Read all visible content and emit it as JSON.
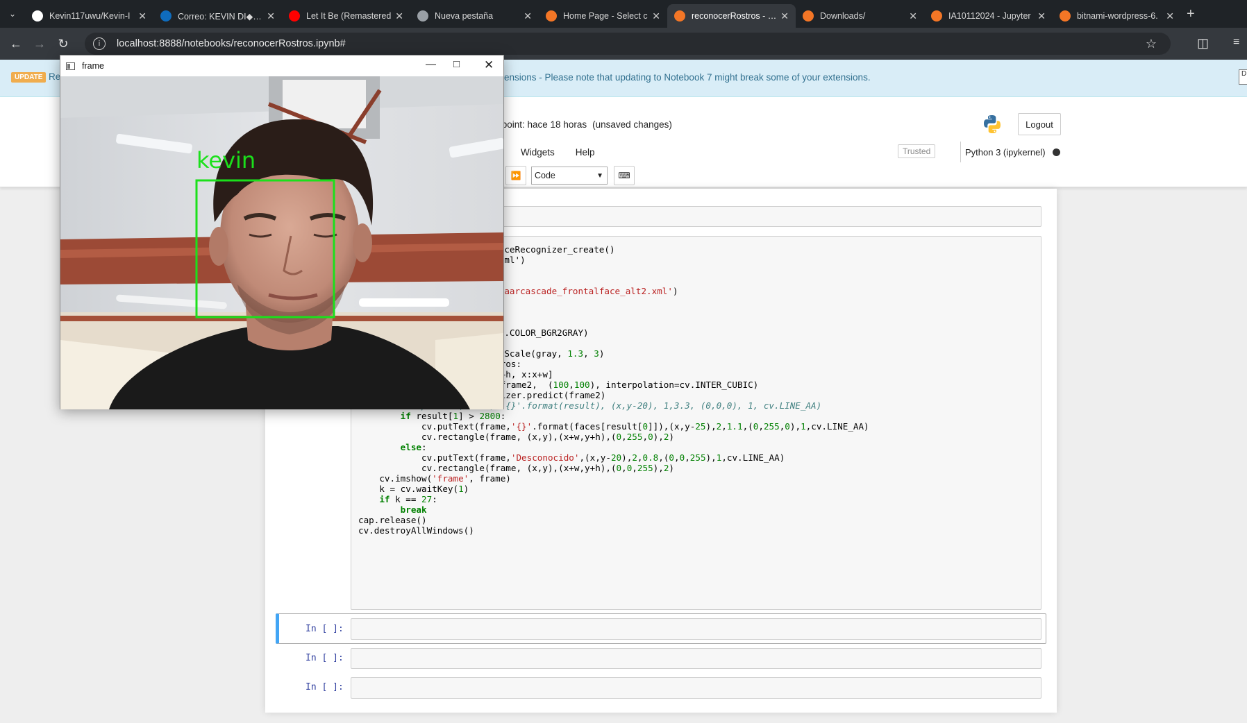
{
  "browser": {
    "tabs": [
      {
        "label": "Kevin117uwu/Kevin-I",
        "icon": "github-icon",
        "color": "#ffffff"
      },
      {
        "label": "Correo: KEVIN DI◆AZ",
        "icon": "outlook-icon",
        "color": "#0f6cbd"
      },
      {
        "label": "Let It Be (Remastered",
        "icon": "youtube-icon",
        "color": "#ff0000"
      },
      {
        "label": "Nueva pestaña",
        "icon": "chrome-icon",
        "color": "#9aa0a6"
      },
      {
        "label": "Home Page - Select c",
        "icon": "jupyter-icon",
        "color": "#f37626"
      },
      {
        "label": "reconocerRostros - Ju",
        "icon": "hourglass-icon",
        "color": "#f37626"
      },
      {
        "label": "Downloads/",
        "icon": "jupyter-icon",
        "color": "#f37626"
      },
      {
        "label": "IA10112024 - Jupyter",
        "icon": "book-icon",
        "color": "#f37626"
      },
      {
        "label": "bitnami-wordpress-6.",
        "icon": "file-icon",
        "color": "#f37626"
      }
    ],
    "active_tab": 5,
    "url": "localhost:8888/notebooks/reconocerRostros.ipynb#"
  },
  "jupyter": {
    "update_badge": "UPDATE",
    "notice_prefix": "Re",
    "notice": "ensions - Please note that updating to Notebook 7 might break some of your extensions.",
    "checkpoint": "kpoint: hace 18 horas",
    "unsaved": "(unsaved changes)",
    "logout": "Logout",
    "menu": [
      "Widgets",
      "Help"
    ],
    "trusted": "Trusted",
    "kernel": "Python 3 (ipykernel)",
    "cell_type": "Code",
    "prompts": [
      "In [ ]:",
      "In [ ]:",
      "In [ ]:"
    ]
  },
  "code_lines": [
    "enFaceRecognizer_create()",
    "ce.xml')",
    "r('haarcascade_frontalface_alt2.xml')",
    ", cv.COLOR_BGR2GRAY)",
    "ultiScale(gray, 1.3, 3)",
    "    for(x, y, w, h) in rostros:",
    "        frame2 = cpGray[y:y+h, x:x+w]",
    "        frame2 = cv.resize(frame2,  (100,100), interpolation=cv.INTER_CUBIC)",
    "        result = faceRecognizer.predict(frame2)",
    "        #cv.putText(frame, '{}'.format(result), (x,y-20), 1,3.3, (0,0,0), 1, cv.LINE_AA)",
    "        if result[1] > 2800:",
    "            cv.putText(frame,'{}'.format(faces[result[0]]),(x,y-25),2,1.1,(0,255,0),1,cv.LINE_AA)",
    "            cv.rectangle(frame, (x,y),(x+w,y+h),(0,255,0),2)",
    "        else:",
    "            cv.putText(frame,'Desconocido',(x,y-20),2,0.8,(0,0,255),1,cv.LINE_AA)",
    "            cv.rectangle(frame, (x,y),(x+w,y+h),(0,0,255),2)",
    "    cv.imshow('frame', frame)",
    "    k = cv.waitKey(1)",
    "    if k == 27:",
    "        break",
    "cap.release()",
    "cv.destroyAllWindows()"
  ],
  "window": {
    "title": "frame",
    "face_label": "kevin",
    "box_color": "#1be01b"
  }
}
